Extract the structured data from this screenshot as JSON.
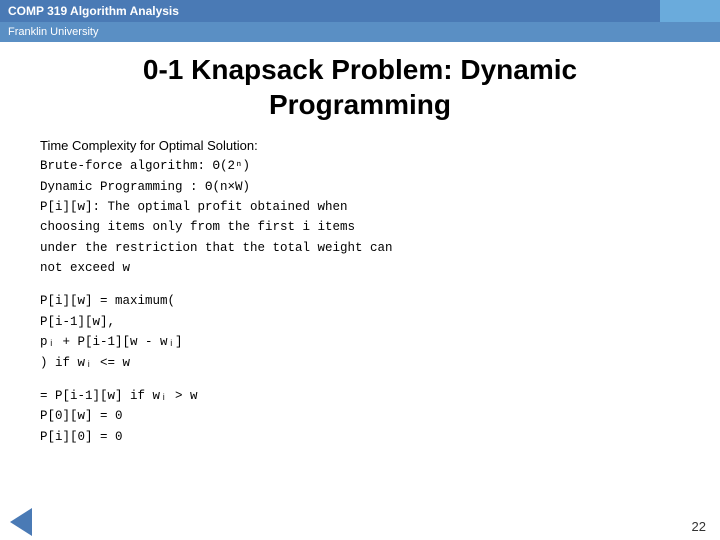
{
  "header": {
    "course": "COMP 319 Algorithm Analysis",
    "university": "Franklin University"
  },
  "slide": {
    "title_line1": "0-1 Knapsack Problem: Dynamic",
    "title_line2": "Programming"
  },
  "content": {
    "complexity_label": "Time Complexity for Optimal Solution:",
    "brute_force": "Brute-force algorithm:  Θ(2ⁿ)",
    "dynamic_prog": "Dynamic Programming :  Θ(n×W)",
    "recurrence_label": "P[i][w]:  The optimal profit obtained when",
    "recurrence_line2": "    choosing items only from the first i items",
    "recurrence_line3": "    under the restriction that the total weight can",
    "recurrence_line4": "    not exceed w",
    "formula_line1": "P[i][w]  =  maximum(",
    "formula_line2": "                P[i-1][w],",
    "formula_line3": "                pᵢ + P[i-1][w - wᵢ]",
    "formula_line4": "                ) if wᵢ <= w",
    "formula_line5": "         =  P[i-1][w]    if wᵢ > w",
    "base1": "P[0][w]  =  0",
    "base2": "P[i][0] = 0",
    "page_number": "22"
  }
}
